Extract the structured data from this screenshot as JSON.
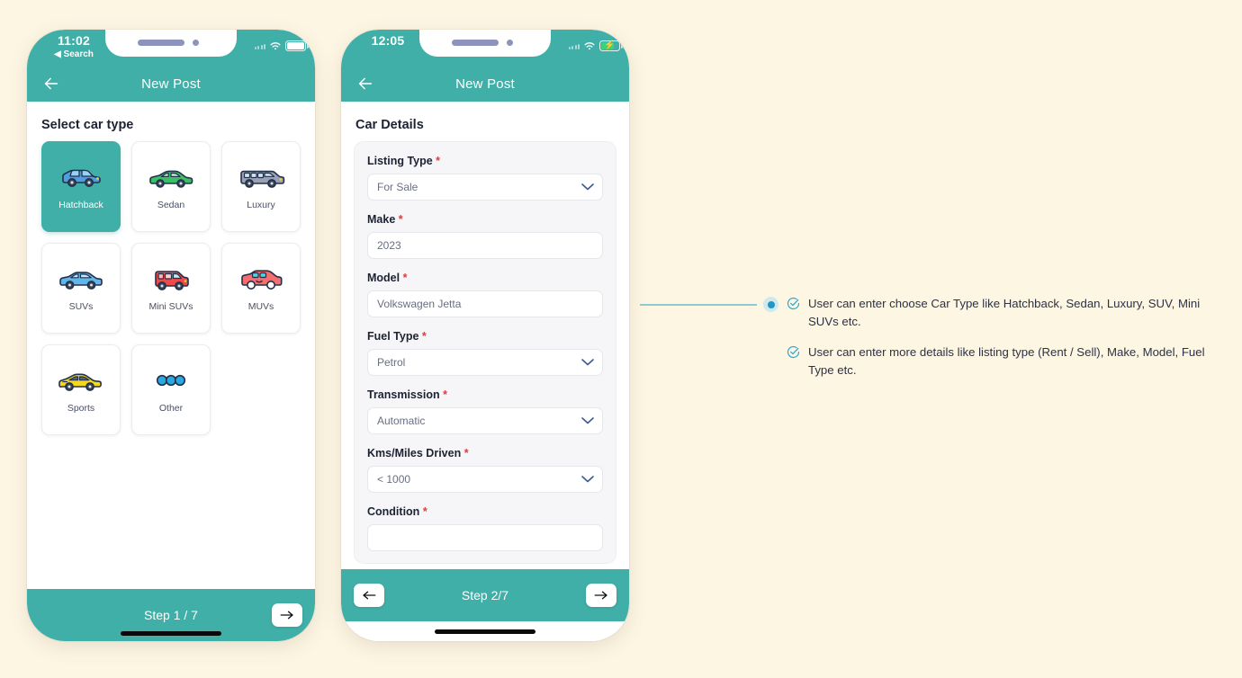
{
  "background_color": "#FDF6E3",
  "accent_color": "#3FAFA8",
  "required_color": "#e03b3b",
  "phone1": {
    "status": {
      "time": "11:02",
      "back_label": "◀ Search",
      "battery": "plain"
    },
    "nav": {
      "title": "New Post",
      "back_icon": "arrow-left-icon"
    },
    "page_title": "Select car type",
    "car_types": [
      {
        "label": "Hatchback",
        "icon": "hatchback-car-icon",
        "color": "#4f9fe0",
        "selected": true
      },
      {
        "label": "Sedan",
        "icon": "sedan-car-icon",
        "color": "#3dbd6a",
        "selected": false
      },
      {
        "label": "Luxury",
        "icon": "luxury-car-icon",
        "color": "#9aa0b5",
        "selected": false
      },
      {
        "label": "SUVs",
        "icon": "suv-car-icon",
        "color": "#5fb6e8",
        "selected": false
      },
      {
        "label": "Mini SUVs",
        "icon": "mini-suv-car-icon",
        "color": "#ef4a4a",
        "selected": false
      },
      {
        "label": "MUVs",
        "icon": "muv-car-icon",
        "color": "#f76c6c",
        "selected": false
      },
      {
        "label": "Sports",
        "icon": "sports-car-icon",
        "color": "#f5d71e",
        "selected": false
      },
      {
        "label": "Other",
        "icon": "three-dots-icon",
        "color": "#2196c4",
        "selected": false
      }
    ],
    "footer": {
      "step": "Step 1 / 7",
      "next_icon": "arrow-right-icon"
    }
  },
  "phone2": {
    "status": {
      "time": "12:05",
      "battery": "charging"
    },
    "nav": {
      "title": "New Post",
      "back_icon": "arrow-left-icon"
    },
    "page_title": "Car Details",
    "fields": [
      {
        "label": "Listing Type",
        "required": "*",
        "value": "For Sale",
        "type": "select"
      },
      {
        "label": "Make",
        "required": "*",
        "value": "2023",
        "type": "text"
      },
      {
        "label": "Model",
        "required": "*",
        "value": "Volkswagen Jetta",
        "type": "text"
      },
      {
        "label": "Fuel Type",
        "required": "*",
        "value": "Petrol",
        "type": "select"
      },
      {
        "label": "Transmission",
        "required": "*",
        "value": "Automatic",
        "type": "select"
      },
      {
        "label": "Kms/Miles Driven",
        "required": "*",
        "value": "< 1000",
        "type": "select"
      },
      {
        "label": "Condition",
        "required": "*",
        "value": "",
        "type": "select"
      }
    ],
    "footer": {
      "step": "Step 2/7",
      "prev_icon": "arrow-left-icon",
      "next_icon": "arrow-right-icon"
    }
  },
  "annotation": {
    "marker_color": "#2196c4",
    "connector_color": "#8ec9d4",
    "notes": [
      "User can enter choose Car Type like Hatchback, Sedan, Luxury, SUV, Mini SUVs etc.",
      "User can enter more details like listing type (Rent / Sell), Make, Model, Fuel Type etc."
    ]
  }
}
